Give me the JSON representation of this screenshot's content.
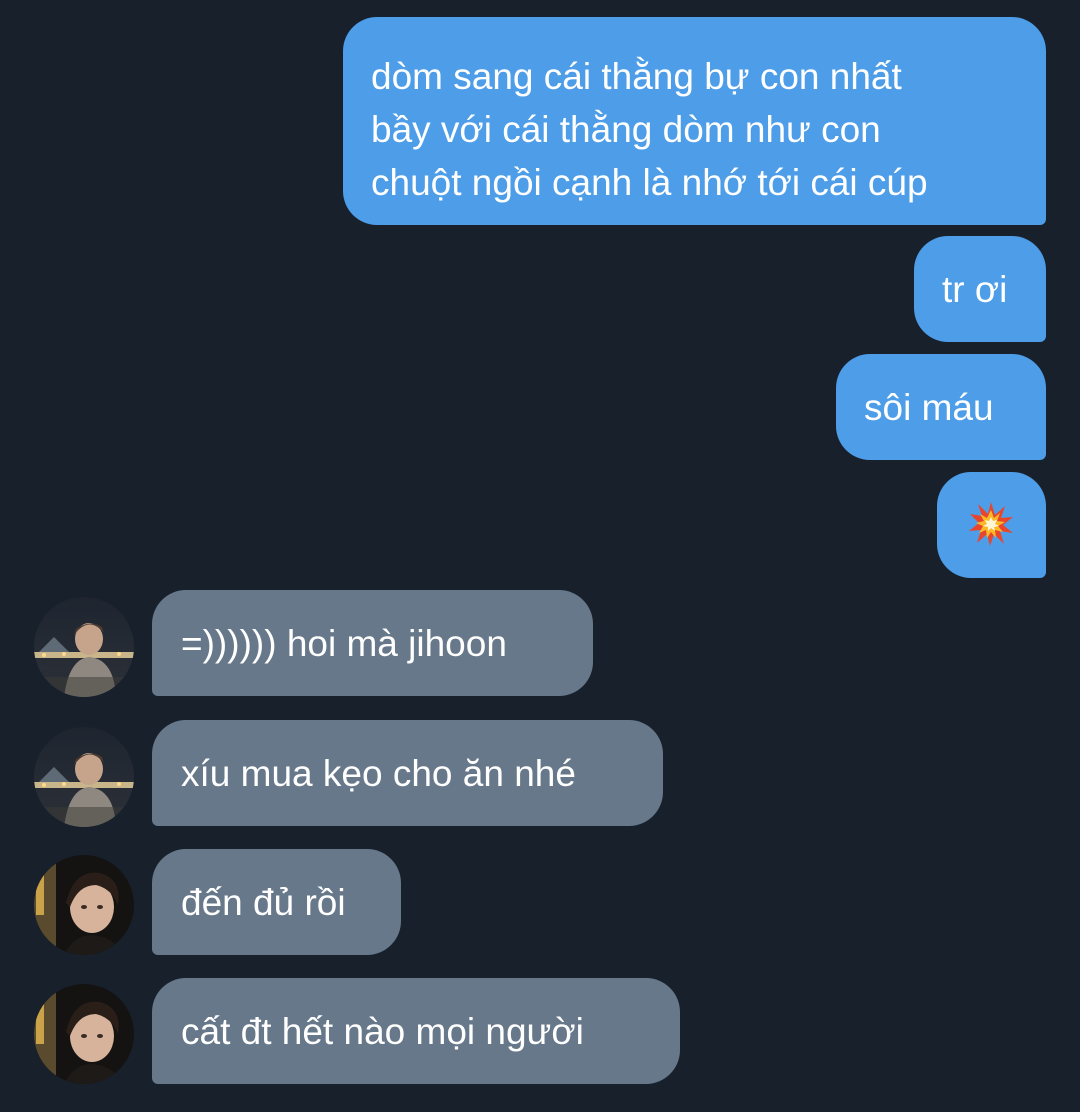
{
  "conversation": {
    "outgoing": [
      {
        "lines": [
          "dòm sang cái thằng bự con nhất",
          "bầy với cái thằng dòm như con",
          "chuột ngồi cạnh là nhớ tới cái cúp"
        ]
      },
      {
        "text": "tr ơi"
      },
      {
        "text": "sôi máu"
      },
      {
        "icon": "collision-emoji-icon"
      }
    ],
    "incoming": [
      {
        "text": "=)))))) hoi mà jihoon",
        "avatar": "avatar-user-night-photo"
      },
      {
        "text": "xíu mua kẹo cho ăn nhé",
        "avatar": "avatar-user-night-photo"
      },
      {
        "text": "đến đủ rồi",
        "avatar": "avatar-user-dark-portrait"
      },
      {
        "text": "cất đt hết nào mọi người",
        "avatar": "avatar-user-dark-portrait"
      }
    ]
  },
  "colors": {
    "background": "#17202b",
    "outgoing_bubble": "#4d9de8",
    "incoming_bubble": "#67788a",
    "text": "#ffffff"
  }
}
